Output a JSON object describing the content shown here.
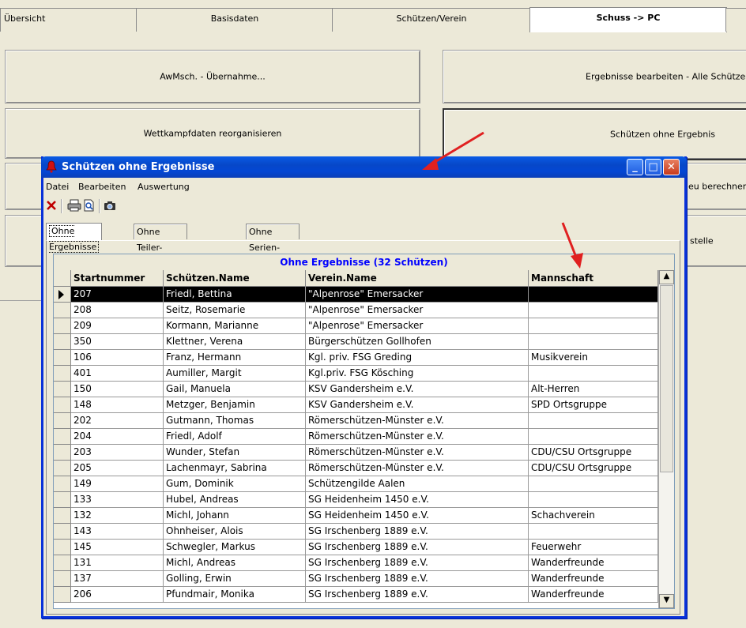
{
  "background": {
    "tabs": [
      {
        "label": "Übersicht"
      },
      {
        "label": "Basisdaten"
      },
      {
        "label": "Schützen/Verein"
      },
      {
        "label": "Schuss -> PC"
      },
      {
        "label": ""
      }
    ],
    "buttons": {
      "awmsch": "AwMsch. - Übernahme...",
      "ergebnisse_bearbeiten": "Ergebnisse bearbeiten - Alle Schützen",
      "wettkampf_reorg": "Wettkampfdaten reorganisieren",
      "schuetzen_ohne_ergebnis": "Schützen ohne Ergebnis",
      "neu_berechnen": "eu berechnen",
      "stelle": "stelle"
    }
  },
  "dialog": {
    "title": "Schützen ohne Ergebnisse",
    "menu": [
      "Datei",
      "Bearbeiten",
      "Auswertung"
    ],
    "toolbar_icons": [
      "delete-icon",
      "print-icon",
      "print-preview-icon",
      "camera-icon"
    ],
    "tabs": [
      "Ohne Ergebnisse",
      "Ohne Teiler-Ergbenisse",
      "Ohne Serien-Ergebnisse"
    ],
    "grid": {
      "caption": "Ohne Ergebnisse (32 Schützen)",
      "columns": [
        "Startnummer",
        "Schützen.Name",
        "Verein.Name",
        "Mannschaft"
      ],
      "rows": [
        [
          "207",
          "Friedl, Bettina",
          "\"Alpenrose\" Emersacker",
          ""
        ],
        [
          "208",
          "Seitz, Rosemarie",
          "\"Alpenrose\" Emersacker",
          ""
        ],
        [
          "209",
          "Kormann, Marianne",
          "\"Alpenrose\" Emersacker",
          ""
        ],
        [
          "350",
          "Klettner, Verena",
          "Bürgerschützen Gollhofen",
          ""
        ],
        [
          "106",
          "Franz, Hermann",
          "Kgl. priv. FSG Greding",
          "Musikverein"
        ],
        [
          "401",
          "Aumiller, Margit",
          "Kgl.priv. FSG Kösching",
          ""
        ],
        [
          "150",
          "Gail, Manuela",
          "KSV Gandersheim e.V.",
          "Alt-Herren"
        ],
        [
          "148",
          "Metzger, Benjamin",
          "KSV Gandersheim e.V.",
          "SPD Ortsgruppe"
        ],
        [
          "202",
          "Gutmann, Thomas",
          "Römerschützen-Münster e.V.",
          ""
        ],
        [
          "204",
          "Friedl, Adolf",
          "Römerschützen-Münster e.V.",
          ""
        ],
        [
          "203",
          "Wunder, Stefan",
          "Römerschützen-Münster e.V.",
          "CDU/CSU Ortsgruppe"
        ],
        [
          "205",
          "Lachenmayr, Sabrina",
          "Römerschützen-Münster e.V.",
          "CDU/CSU Ortsgruppe"
        ],
        [
          "149",
          "Gum, Dominik",
          "Schützengilde Aalen",
          ""
        ],
        [
          "133",
          "Hubel, Andreas",
          "SG Heidenheim 1450 e.V.",
          ""
        ],
        [
          "132",
          "Michl, Johann",
          "SG Heidenheim 1450 e.V.",
          "Schachverein"
        ],
        [
          "143",
          "Ohnheiser, Alois",
          "SG Irschenberg 1889 e.V.",
          ""
        ],
        [
          "145",
          "Schwegler, Markus",
          "SG Irschenberg 1889 e.V.",
          "Feuerwehr"
        ],
        [
          "131",
          "Michl, Andreas",
          "SG Irschenberg 1889 e.V.",
          "Wanderfreunde"
        ],
        [
          "137",
          "Golling, Erwin",
          "SG Irschenberg 1889 e.V.",
          "Wanderfreunde"
        ],
        [
          "206",
          "Pfundmair, Monika",
          "SG Irschenberg 1889 e.V.",
          "Wanderfreunde"
        ]
      ]
    }
  },
  "colors": {
    "title_bar": "#0a5be5",
    "caption_text": "#0000ff",
    "arrow": "#e02020"
  }
}
